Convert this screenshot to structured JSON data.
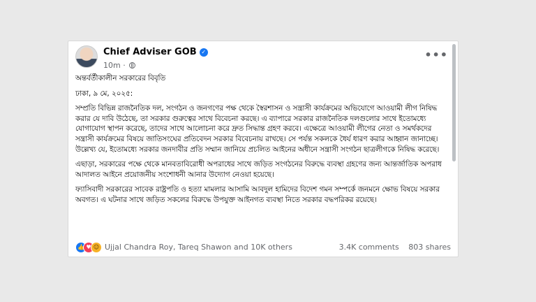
{
  "post": {
    "author": "Chief Adviser GOB",
    "time": "10m",
    "title": "অন্তর্বর্তীকালীন সরকারের বিবৃতি",
    "dateline": "ঢাকা, ৯ মে, ২০২৫:",
    "paragraphs": [
      "সম্প্রতি বিভিন্ন রাজনৈতিক দল, সংগঠন ও জনগণের পক্ষ থেকে স্বৈরশাসন ও সন্ত্রাসী কার্যক্রমের অভিযোগে আওয়ামী লীগ নিষিদ্ধ করার যে দাবি উঠেছে, তা সরকার গুরুত্বের সাথে বিবেচনা করছে। এ ব্যাপারে সরকার রাজনৈতিক দলগুলোর সাথে ইতোমধ্যে যোগাযোগ স্থাপন করেছে, তাদের সাথে আলোচনা করে দ্রুত সিদ্ধান্ত গ্রহণ করবে। এক্ষেত্রে আওয়ামী লীগের নেতা ও সমর্থকদের সন্ত্রাসী কার্যক্রমের বিষয়ে জাতিসংঘের প্রতিবেদন সরকার বিবেচনায় রাখছে। সে পর্যন্ত সকলকে ধৈর্য ধারণ করার আহ্বান জানাচ্ছে। উল্লেখ্য যে, ইতোমধ্যে সরকার জনদাবীর প্রতি সম্মান জানিয়ে প্রচলিত আইনের অধীনে সন্ত্রাসী সংগঠন ছাত্রলীগকে নিষিদ্ধ করেছে।",
      "এছাড়া, সরকারের পক্ষে থেকে মানবতাবিরোধী অপরাধের সাথে জড়িত সংগঠনের বিরুদ্ধে ব্যবস্থা গ্রহণের জন্য আন্তর্জাতিক অপরাধ আদালত আইনে প্রয়োজনীয় সংশোধনী আনার উদ্যোগ নেওয়া হয়েছে।",
      "ফ্যাসিবাদী সরকারের সাবেক রাষ্ট্রপতি ও হত্যা মামলার আসামি আবদুল হামিদের বিদেশ গমন সম্পর্কে জনমনে ক্ষোভ বিষয়ে সরকার অবগত। এ ঘটনার সাথে জড়িত সকলের বিরুদ্ধে উপযুক্ত আইনগত ব্যবস্থা নিতে সরকার বদ্ধপরিকর রয়েছে।"
    ],
    "reactions": {
      "icons": [
        "like-icon",
        "love-icon",
        "haha-icon"
      ],
      "names": "Ujjal Chandra Roy, Tareq Shawon and 10K others"
    },
    "comments": "3.4K comments",
    "shares": "803 shares",
    "colors": {
      "background": "#e9e9e9",
      "card": "#ffffff",
      "verified": "#1877f2",
      "secondary_text": "#65676b"
    }
  }
}
